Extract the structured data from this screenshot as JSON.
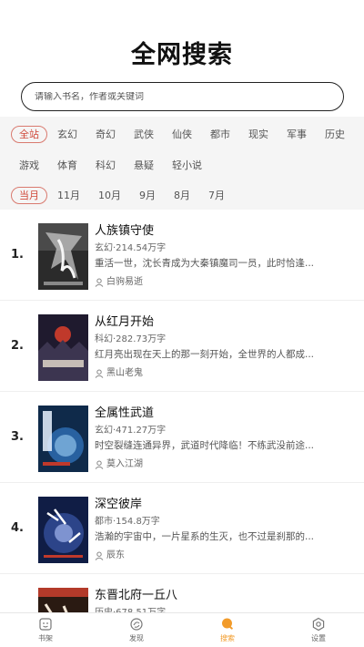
{
  "page_title": "全网搜索",
  "search": {
    "placeholder": "请输入书名，作者或关键词",
    "value": ""
  },
  "categories": [
    "全站",
    "玄幻",
    "奇幻",
    "武侠",
    "仙侠",
    "都市",
    "现实",
    "军事",
    "历史",
    "游戏",
    "体育",
    "科幻",
    "悬疑",
    "轻小说"
  ],
  "months": [
    "当月",
    "11月",
    "10月",
    "9月",
    "8月",
    "7月"
  ],
  "books": [
    {
      "rank": "1.",
      "title": "人族镇守使",
      "meta": "玄幻·214.54万字",
      "desc": "重活一世，沈长青成为大秦镇魔司一员，此时恰逢...",
      "author": "白驹易逝"
    },
    {
      "rank": "2.",
      "title": "从红月开始",
      "meta": "科幻·282.73万字",
      "desc": "红月亮出现在天上的那一刻开始，全世界的人都成...",
      "author": "黑山老鬼"
    },
    {
      "rank": "3.",
      "title": "全属性武道",
      "meta": "玄幻·471.27万字",
      "desc": "时空裂缝连通异界，武道时代降临！不练武没前途...",
      "author": "莫入江湖"
    },
    {
      "rank": "4.",
      "title": "深空彼岸",
      "meta": "都市·154.8万字",
      "desc": "浩瀚的宇宙中，一片星系的生灭，也不过是刹那的...",
      "author": "辰东"
    },
    {
      "rank": "5.",
      "title": "东晋北府一丘八",
      "meta": "历史·678.51万字",
      "desc": "",
      "author": ""
    }
  ],
  "tabs": [
    {
      "label": "书架",
      "icon": "bookshelf-icon"
    },
    {
      "label": "发现",
      "icon": "discover-icon"
    },
    {
      "label": "搜索",
      "icon": "search-icon"
    },
    {
      "label": "设置",
      "icon": "settings-icon"
    }
  ],
  "colors": {
    "accent": "#d04a3b",
    "tab_active": "#f29b2a"
  }
}
